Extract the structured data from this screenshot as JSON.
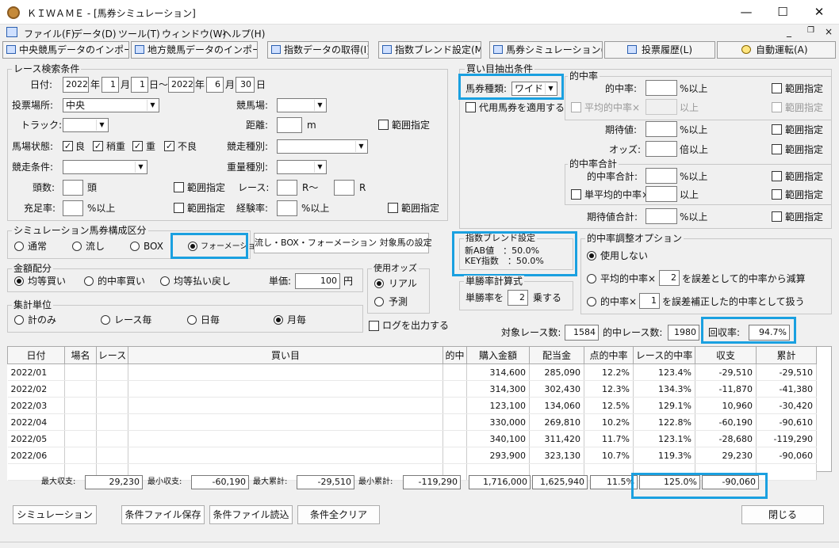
{
  "window": {
    "title": "ＫＩＷＡＭＥ - [馬券シミュレーション]"
  },
  "menu": [
    "ファイル(F)",
    "データ(D)",
    "ツール(T)",
    "ウィンドウ(W)",
    "ヘルプ(H)"
  ],
  "nav": [
    "中央競馬データのインポート(J)",
    "地方競馬データのインポート(N)",
    "指数データの取得(I)",
    "指数ブレンド設定(M)",
    "馬券シミュレーション(B)",
    "投票履歴(L)",
    "自動運転(A)"
  ],
  "race": {
    "title": "レース検索条件",
    "date_label": "日付:",
    "from_year": "2022",
    "y1": "年",
    "from_month": "1",
    "m1": "月",
    "from_day": "1",
    "d1": "日～",
    "to_year": "2022",
    "y2": "年",
    "to_month": "6",
    "m2": "月",
    "to_day": "30",
    "d2": "日",
    "venue_label": "投票場所:",
    "venue": "中央",
    "course_label": "競馬場:",
    "track_label": "トラック:",
    "distance_label": "距離:",
    "distance_unit": "m",
    "range_label": "範囲指定",
    "condition_label": "馬場状態:",
    "cond": [
      "良",
      "稍重",
      "重",
      "不良"
    ],
    "race_type_label": "競走種別:",
    "race_cond_label": "競走条件:",
    "weight_type_label": "重量種別:",
    "heads_label": "頭数:",
    "heads_unit": "頭",
    "race_label": "レース:",
    "race_r1": "R～",
    "race_r2": "R",
    "fill_label": "充足率:",
    "pct_over": "%以上",
    "exp_label": "経験率:"
  },
  "sim": {
    "title": "シミュレーション馬券構成区分",
    "opts": [
      "通常",
      "流し",
      "BOX",
      "フォーメーション"
    ],
    "setting_btn": "流し・BOX・フォーメーション 対象馬の設定"
  },
  "amount": {
    "title": "金額配分",
    "opts": [
      "均等買い",
      "的中率買い",
      "均等払い戻し"
    ],
    "unit_label": "単価:",
    "unit_value": "100",
    "yen": "円"
  },
  "odds": {
    "title": "使用オッズ",
    "opts": [
      "リアル",
      "予測"
    ]
  },
  "agg": {
    "title": "集計単位",
    "opts": [
      "計のみ",
      "レース毎",
      "日毎",
      "月毎"
    ],
    "log_label": "ログを出力する"
  },
  "buy": {
    "title": "買い目抽出条件",
    "ticket_label": "馬券種類:",
    "ticket_value": "ワイド",
    "alt_label": "代用馬券を適用する",
    "hit_title": "的中率",
    "hit_label": "的中率:",
    "pct_over": "%以上",
    "avg_hit_label": "平均的中率×",
    "over": "以上",
    "range_label": "範囲指定",
    "exp_label": "期待値:",
    "odds_label": "オッズ:",
    "odds_unit": "倍以上",
    "sum_title": "的中率合計",
    "sum_label": "的中率合計:",
    "single_avg_label": "単平均的中率×",
    "exp_sum_label": "期待値合計:"
  },
  "blend": {
    "title": "指数ブレンド設定",
    "line1": "新AB値　：50.0%",
    "line2": "KEY指数　：50.0%"
  },
  "win": {
    "title": "単勝率計算式",
    "prefix": "単勝率を",
    "value": "2",
    "suffix": "乗する"
  },
  "adj": {
    "title": "的中率調整オプション",
    "opt1": "使用しない",
    "opt2a": "平均的中率×",
    "opt2_val": "2",
    "opt2b": "を誤差として的中率から減算",
    "opt3a": "的中率×",
    "opt3_val": "1",
    "opt3b": "を誤差補正した的中率として扱う"
  },
  "stats": {
    "target_label": "対象レース数:",
    "target": "1584",
    "hit_label": "的中レース数:",
    "hit": "1980",
    "recovery_label": "回収率:",
    "recovery": "94.7%"
  },
  "table": {
    "headers": [
      "日付",
      "場名",
      "レース",
      "買い目",
      "的中",
      "購入金額",
      "配当金",
      "点的中率",
      "レース的中率",
      "収支",
      "累計"
    ],
    "rows": [
      [
        "2022/01",
        "",
        "",
        "",
        "",
        "314,600",
        "285,090",
        "12.2%",
        "123.4%",
        "-29,510",
        "-29,510"
      ],
      [
        "2022/02",
        "",
        "",
        "",
        "",
        "314,300",
        "302,430",
        "12.3%",
        "134.3%",
        "-11,870",
        "-41,380"
      ],
      [
        "2022/03",
        "",
        "",
        "",
        "",
        "123,100",
        "134,060",
        "12.5%",
        "129.1%",
        "10,960",
        "-30,420"
      ],
      [
        "2022/04",
        "",
        "",
        "",
        "",
        "330,000",
        "269,810",
        "10.2%",
        "122.8%",
        "-60,190",
        "-90,610"
      ],
      [
        "2022/05",
        "",
        "",
        "",
        "",
        "340,100",
        "311,420",
        "11.7%",
        "123.1%",
        "-28,680",
        "-119,290"
      ],
      [
        "2022/06",
        "",
        "",
        "",
        "",
        "293,900",
        "323,130",
        "10.7%",
        "119.3%",
        "29,230",
        "-90,060"
      ]
    ]
  },
  "footer": {
    "max_profit_label": "最大収支:",
    "max_profit": "29,230",
    "min_profit_label": "最小収支:",
    "min_profit": "-60,190",
    "max_cum_label": "最大累計:",
    "max_cum": "-29,510",
    "min_cum_label": "最小累計:",
    "min_cum": "-119,290",
    "total_buy": "1,716,000",
    "total_pay": "1,625,940",
    "total_hit": "11.5%",
    "total_race_hit": "125.0%",
    "total_balance": "-90,060"
  },
  "buttons": {
    "simulate": "シミュレーション",
    "save": "条件ファイル保存",
    "load": "条件ファイル読込",
    "clear": "条件全クリア",
    "close": "閉じる"
  }
}
